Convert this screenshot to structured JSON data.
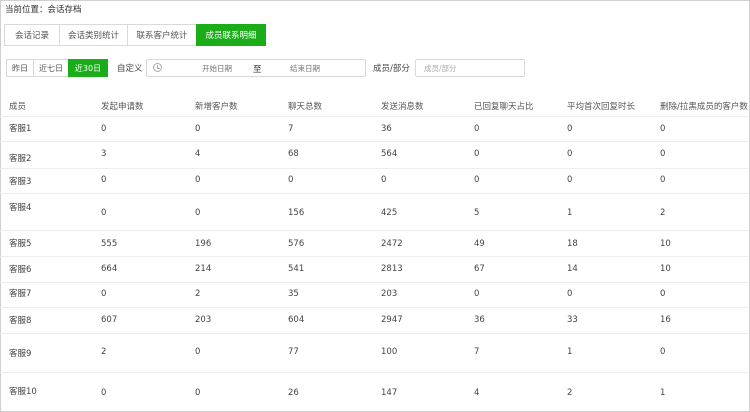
{
  "breadcrumb": "当前位置：会话存档",
  "tabs": [
    {
      "label": "会话记录",
      "active": false
    },
    {
      "label": "会话类别统计",
      "active": false
    },
    {
      "label": "联系客户统计",
      "active": false
    },
    {
      "label": "成员联系明细",
      "active": true
    }
  ],
  "range_buttons": [
    {
      "label": "昨日",
      "active": false
    },
    {
      "label": "近七日",
      "active": false
    },
    {
      "label": "近30日",
      "active": true
    }
  ],
  "custom_label": "自定义",
  "date_start_placeholder": "开始日期",
  "date_separator": "至",
  "date_end_placeholder": "结束日期",
  "member_label": "成员/部分",
  "member_placeholder": "成员/部分",
  "columns": [
    "成员",
    "发起申请数",
    "新增客户数",
    "聊天总数",
    "发送消息数",
    "已回复聊天占比",
    "平均首次回复时长",
    "删除/拉黑成员的客户数"
  ],
  "rows": [
    [
      "客服1",
      "0",
      "0",
      "7",
      "36",
      "0",
      "0",
      "0"
    ],
    [
      "客服2",
      "3",
      "4",
      "68",
      "564",
      "0",
      "0",
      "0"
    ],
    [
      "客服3",
      "0",
      "0",
      "0",
      "0",
      "0",
      "0",
      "0"
    ],
    [
      "客服4",
      "0",
      "0",
      "156",
      "425",
      "5",
      "1",
      "2"
    ],
    [
      "客服5",
      "555",
      "196",
      "576",
      "2472",
      "49",
      "18",
      "10"
    ],
    [
      "客服6",
      "664",
      "214",
      "541",
      "2813",
      "67",
      "14",
      "10"
    ],
    [
      "客服7",
      "0",
      "2",
      "35",
      "203",
      "0",
      "0",
      "0"
    ],
    [
      "客服8",
      "607",
      "203",
      "604",
      "2947",
      "36",
      "33",
      "16"
    ],
    [
      "客服9",
      "2",
      "0",
      "77",
      "100",
      "7",
      "1",
      "0"
    ],
    [
      "客服10",
      "0",
      "0",
      "26",
      "147",
      "4",
      "2",
      "1"
    ]
  ],
  "colors": {
    "accent": "#1aad19",
    "border": "#d9d9d9",
    "text": "#444444"
  }
}
